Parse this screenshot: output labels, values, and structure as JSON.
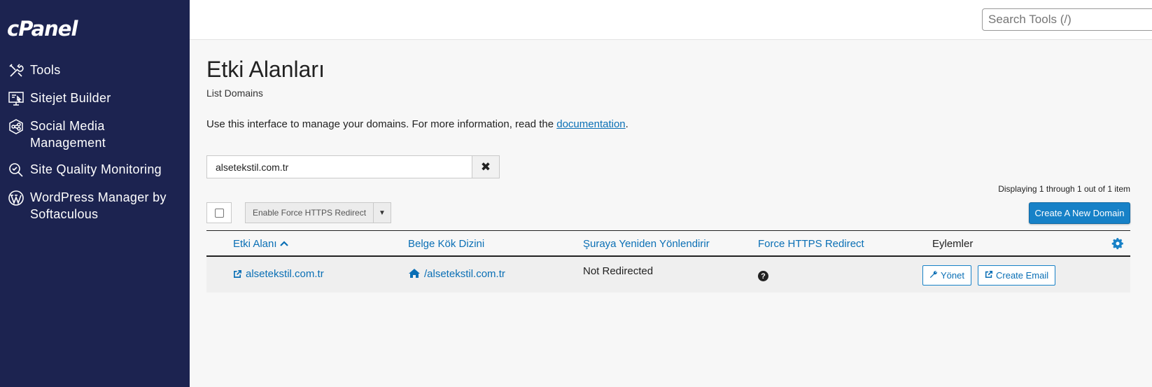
{
  "brand": {
    "logo_text": "cPanel"
  },
  "sidebar": {
    "items": [
      {
        "label": "Tools",
        "icon": "tools-icon"
      },
      {
        "label": "Sitejet Builder",
        "icon": "sitejet-icon"
      },
      {
        "label": "Social Media Management",
        "icon": "social-media-icon"
      },
      {
        "label": "Site Quality Monitoring",
        "icon": "site-quality-icon"
      },
      {
        "label": "WordPress Manager by Softaculous",
        "icon": "wordpress-icon"
      }
    ]
  },
  "topbar": {
    "search_placeholder": "Search Tools (/)"
  },
  "page": {
    "title": "Etki Alanları",
    "subtitle": "List Domains",
    "intro_text": "Use this interface to manage your domains. For more information, read the ",
    "intro_link": "documentation",
    "intro_end": "."
  },
  "filter": {
    "value": "alsetekstil.com.tr"
  },
  "pagination": {
    "text": "Displaying 1 through 1 out of 1 item"
  },
  "toolbar": {
    "bulk_action_label": "Enable Force HTTPS Redirect",
    "create_label": "Create A New Domain"
  },
  "table": {
    "headers": {
      "domain": "Etki Alanı",
      "docroot": "Belge Kök Dizini",
      "redirect": "Şuraya Yeniden Yönlendirir",
      "https": "Force HTTPS Redirect",
      "actions": "Eylemler"
    },
    "rows": [
      {
        "domain": "alsetekstil.com.tr",
        "docroot": "/alsetekstil.com.tr",
        "redirect": "Not Redirected",
        "manage_label": "Yönet",
        "email_label": "Create Email"
      }
    ]
  },
  "colors": {
    "sidebar": "#1c2350",
    "accent": "#1781c7",
    "link": "#0a6fb5"
  }
}
